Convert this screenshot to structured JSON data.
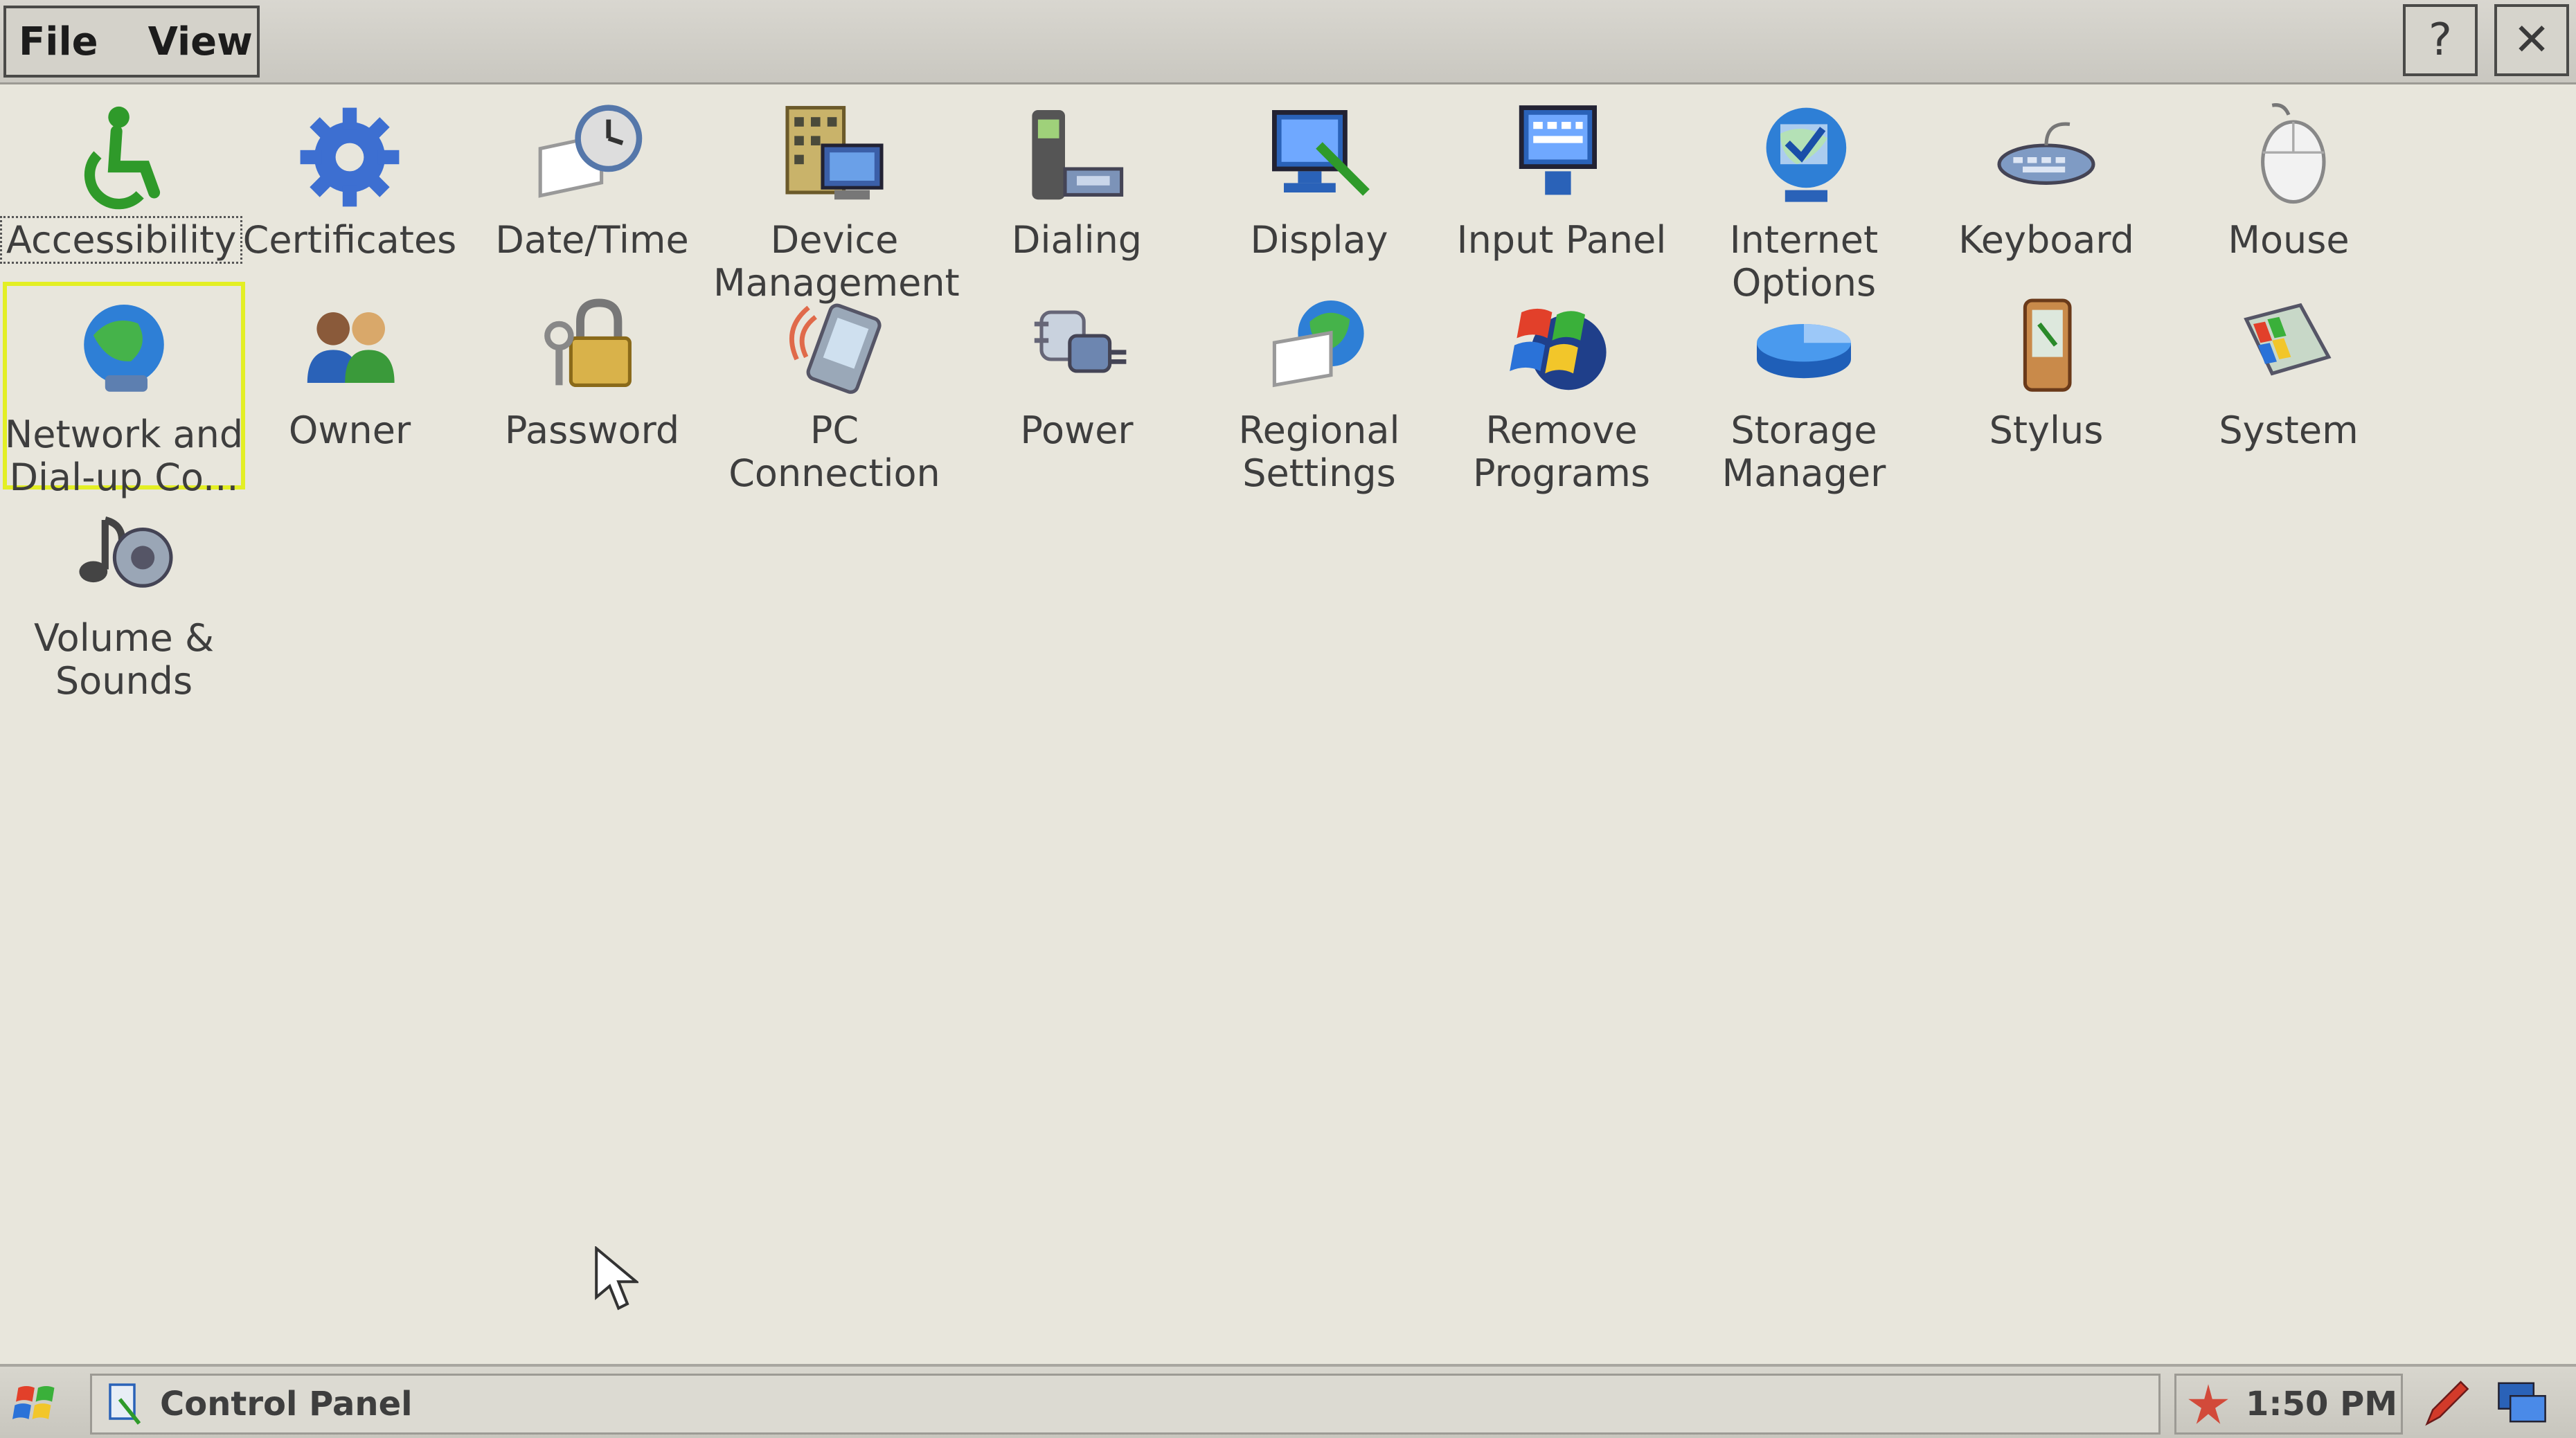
{
  "menu": {
    "file_label": "File",
    "view_label": "View",
    "help_label": "?",
    "close_label": "✕"
  },
  "items": [
    {
      "label": "Accessibility",
      "icon": "accessibility-icon"
    },
    {
      "label": "Certificates",
      "icon": "gear-icon"
    },
    {
      "label": "Date/Time",
      "icon": "clock-calendar-icon"
    },
    {
      "label": "Device\nManagement",
      "icon": "building-icon"
    },
    {
      "label": "Dialing",
      "icon": "phone-icon"
    },
    {
      "label": "Display",
      "icon": "monitor-brush-icon"
    },
    {
      "label": "Input Panel",
      "icon": "keyboard-monitor-icon"
    },
    {
      "label": "Internet\nOptions",
      "icon": "globe-check-icon"
    },
    {
      "label": "Keyboard",
      "icon": "keyboard-icon"
    },
    {
      "label": "Mouse",
      "icon": "mouse-icon"
    },
    {
      "label": "Network and\nDial-up Co...",
      "icon": "network-globe-icon"
    },
    {
      "label": "Owner",
      "icon": "users-icon"
    },
    {
      "label": "Password",
      "icon": "lock-keys-icon"
    },
    {
      "label": "PC\nConnection",
      "icon": "pda-signal-icon"
    },
    {
      "label": "Power",
      "icon": "power-plug-icon"
    },
    {
      "label": "Regional\nSettings",
      "icon": "globe-calendar-icon"
    },
    {
      "label": "Remove\nPrograms",
      "icon": "windows-globe-icon"
    },
    {
      "label": "Storage\nManager",
      "icon": "pie-disk-icon"
    },
    {
      "label": "Stylus",
      "icon": "stylus-pda-icon"
    },
    {
      "label": "System",
      "icon": "system-book-icon"
    },
    {
      "label": "Volume &\nSounds",
      "icon": "music-speaker-icon"
    }
  ],
  "taskbar": {
    "window_label": "Control Panel",
    "clock": "1:50 PM"
  },
  "colors": {
    "selection": "#e3ef24",
    "background": "#e8e6dc"
  }
}
